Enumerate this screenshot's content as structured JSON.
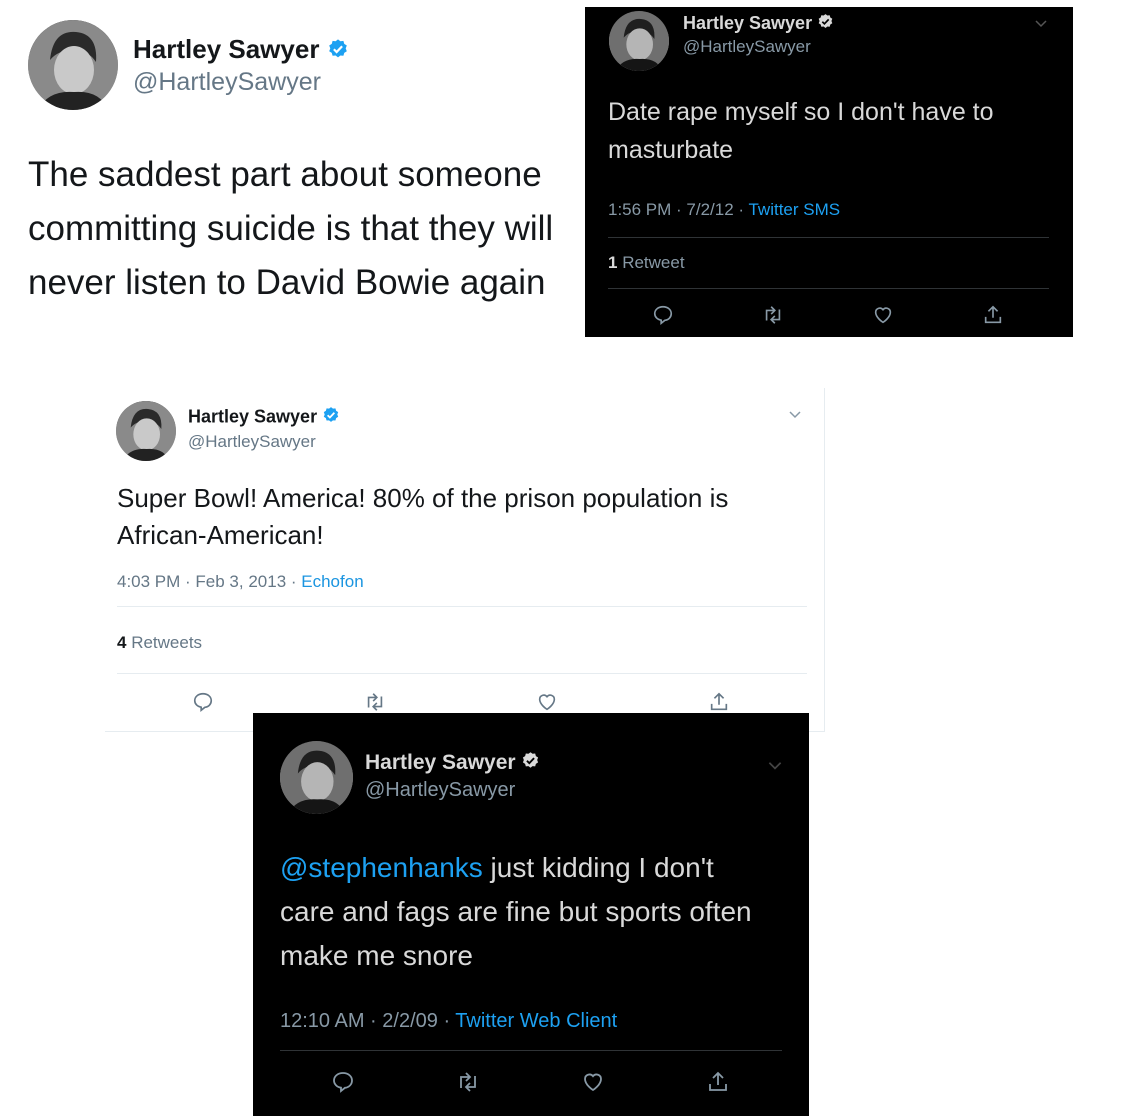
{
  "tweets": [
    {
      "name": "Hartley Sawyer",
      "handle": "@HartleySawyer",
      "text": "The saddest part about someone\ncommitting suicide is that they will\nnever listen to David Bowie again"
    },
    {
      "name": "Hartley Sawyer",
      "handle": "@HartleySawyer",
      "text": "Date rape myself so I don't have to\nmasturbate",
      "time": "1:56 PM · 7/2/12 · ",
      "source": "Twitter SMS",
      "retweet_count": "1",
      "retweet_label": " Retweet"
    },
    {
      "name": "Hartley Sawyer",
      "handle": "@HartleySawyer",
      "text": "Super Bowl! America! 80% of the prison population is\nAfrican-American!",
      "time": "4:03 PM · Feb 3, 2013 · ",
      "source": "Echofon",
      "retweet_count": "4",
      "retweet_label": " Retweets"
    },
    {
      "name": "Hartley Sawyer",
      "handle": "@HartleySawyer",
      "mention": "@stephenhanks",
      "text": " just kidding I don't\ncare and fags are fine but sports often\nmake me snore",
      "time": "12:10 AM · 2/2/09 · ",
      "source": "Twitter Web Client"
    }
  ],
  "icons": [
    "verified-badge-icon",
    "chevron-down-icon",
    "reply-icon",
    "retweet-icon",
    "like-icon",
    "share-icon"
  ],
  "colors": {
    "verified": "#1da1f2",
    "dark_bg": "#000000",
    "link": "#1da1f2"
  }
}
